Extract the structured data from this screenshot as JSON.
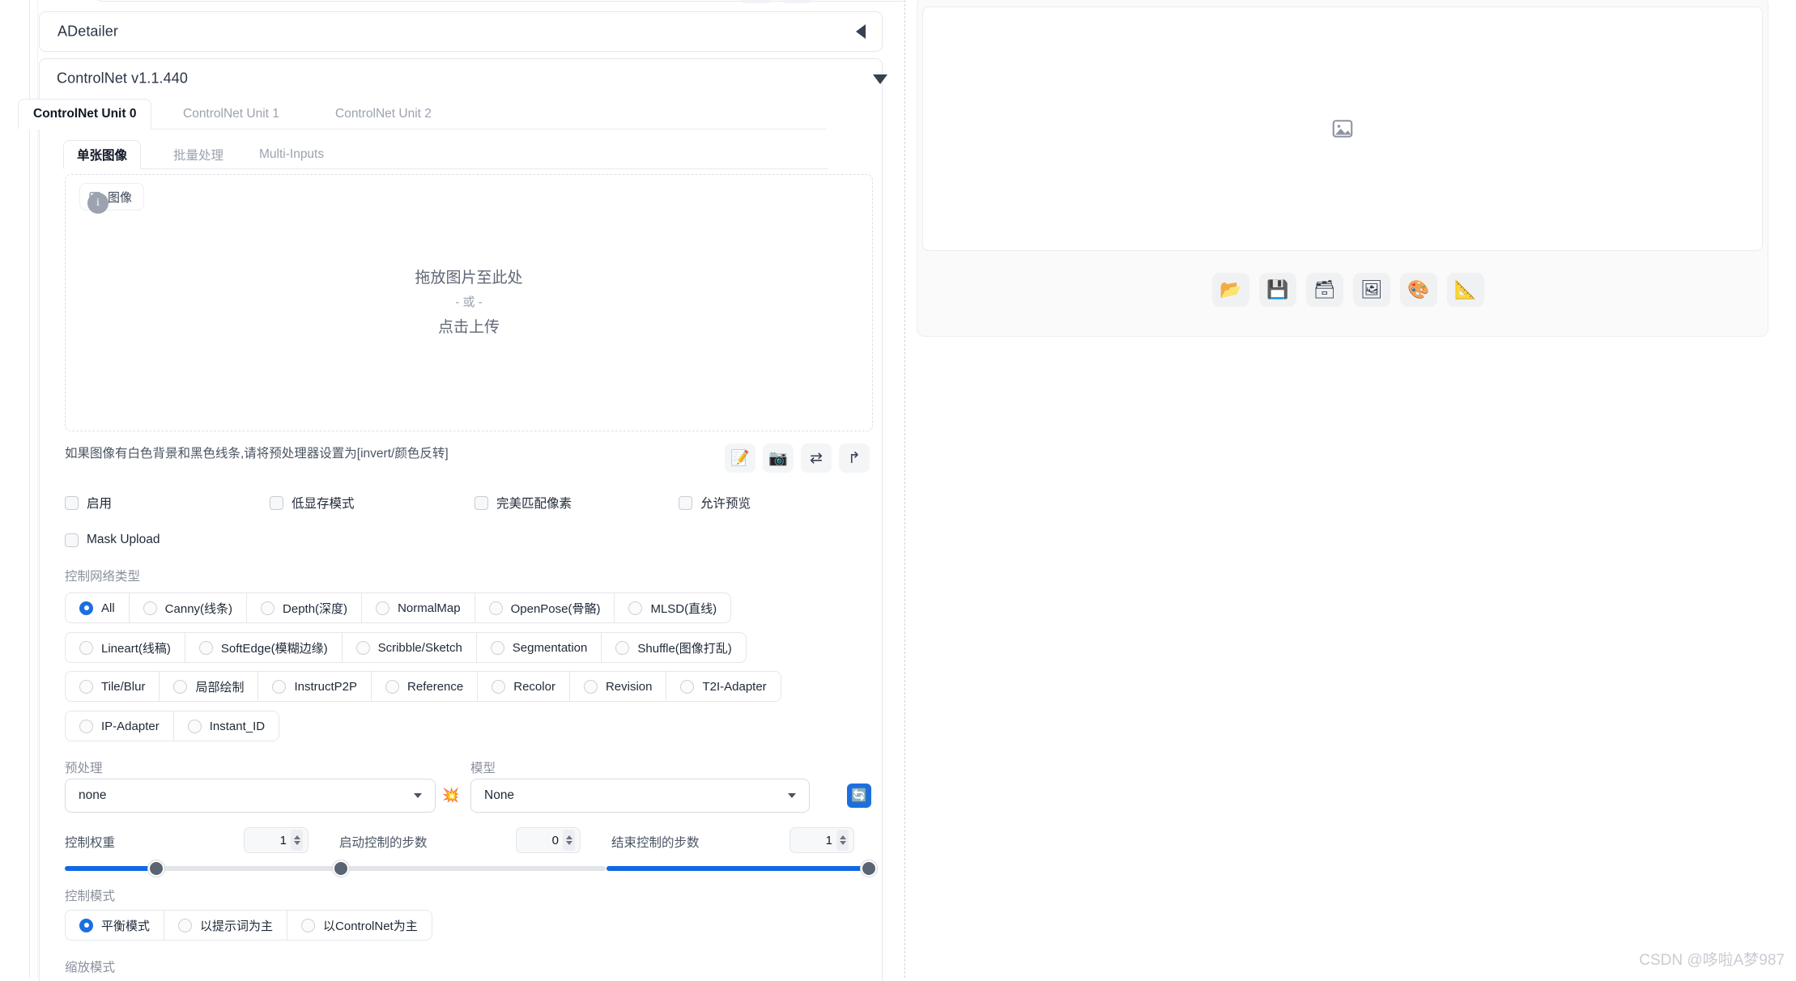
{
  "accordions": {
    "adetailer": {
      "title": "ADetailer",
      "arrow": "triangle-left"
    },
    "controlnet": {
      "title": "ControlNet v1.1.440",
      "arrow": "triangle-down"
    }
  },
  "unit_tabs": [
    {
      "label": "ControlNet Unit 0",
      "active": true
    },
    {
      "label": "ControlNet Unit 1",
      "active": false
    },
    {
      "label": "ControlNet Unit 2",
      "active": false
    }
  ],
  "image_tabs": [
    {
      "label": "单张图像",
      "active": true
    },
    {
      "label": "批量处理",
      "active": false
    },
    {
      "label": "Multi-Inputs",
      "active": false
    }
  ],
  "dropzone": {
    "chip_label": "图像",
    "chip_icon": "image-icon",
    "badge": "i",
    "line1": "拖放图片至此处",
    "line2": "- 或 -",
    "line3": "点击上传"
  },
  "hint": "如果图像有白色背景和黑色线条,请将预处理器设置为[invert/颜色反转]",
  "image_tools": [
    {
      "name": "edit-note-icon",
      "glyph": "📝"
    },
    {
      "name": "camera-icon",
      "glyph": "📷"
    },
    {
      "name": "swap-arrows-icon",
      "glyph": "⇄"
    },
    {
      "name": "undo-arrow-icon",
      "glyph": "↱"
    }
  ],
  "checkboxes": [
    {
      "label": "启用",
      "checked": false
    },
    {
      "label": "低显存模式",
      "checked": false
    },
    {
      "label": "完美匹配像素",
      "checked": false
    },
    {
      "label": "允许预览",
      "checked": false
    },
    {
      "label": "Mask Upload",
      "checked": false
    }
  ],
  "control_type": {
    "label": "控制网络类型",
    "rows": [
      [
        {
          "label": "All",
          "selected": true
        },
        {
          "label": "Canny(线条)",
          "selected": false
        },
        {
          "label": "Depth(深度)",
          "selected": false
        },
        {
          "label": "NormalMap",
          "selected": false
        },
        {
          "label": "OpenPose(骨骼)",
          "selected": false
        },
        {
          "label": "MLSD(直线)",
          "selected": false
        }
      ],
      [
        {
          "label": "Lineart(线稿)",
          "selected": false
        },
        {
          "label": "SoftEdge(模糊边缘)",
          "selected": false
        },
        {
          "label": "Scribble/Sketch",
          "selected": false
        },
        {
          "label": "Segmentation",
          "selected": false
        },
        {
          "label": "Shuffle(图像打乱)",
          "selected": false
        }
      ],
      [
        {
          "label": "Tile/Blur",
          "selected": false
        },
        {
          "label": "局部绘制",
          "selected": false
        },
        {
          "label": "InstructP2P",
          "selected": false
        },
        {
          "label": "Reference",
          "selected": false
        },
        {
          "label": "Recolor",
          "selected": false
        },
        {
          "label": "Revision",
          "selected": false
        },
        {
          "label": "T2I-Adapter",
          "selected": false
        }
      ],
      [
        {
          "label": "IP-Adapter",
          "selected": false
        },
        {
          "label": "Instant_ID",
          "selected": false
        }
      ]
    ]
  },
  "preprocessor": {
    "label": "预处理",
    "value": "none",
    "explode_icon": "explosion-icon",
    "explode_glyph": "💥"
  },
  "model": {
    "label": "模型",
    "value": "None",
    "refresh_icon": "refresh-icon",
    "refresh_glyph": "🔄"
  },
  "sliders": [
    {
      "label": "控制权重",
      "value": "1",
      "fill_pct": 34
    },
    {
      "label": "启动控制的步数",
      "value": "0",
      "fill_pct": 0
    },
    {
      "label": "结束控制的步数",
      "value": "1",
      "fill_pct": 100
    }
  ],
  "control_mode": {
    "label": "控制模式",
    "options": [
      {
        "label": "平衡模式",
        "selected": true
      },
      {
        "label": "以提示词为主",
        "selected": false
      },
      {
        "label": "以ControlNet为主",
        "selected": false
      }
    ]
  },
  "resize_mode": {
    "label": "缩放模式"
  },
  "output": {
    "placeholder_icon": "image-placeholder-icon",
    "tools": [
      {
        "name": "folder-icon",
        "glyph": "📂"
      },
      {
        "name": "save-floppy-icon",
        "glyph": "💾"
      },
      {
        "name": "card-file-box-icon",
        "glyph": "🗃"
      },
      {
        "name": "framed-picture-icon",
        "glyph": "🖼"
      },
      {
        "name": "artist-palette-icon",
        "glyph": "🎨"
      },
      {
        "name": "triangular-ruler-icon",
        "glyph": "📐"
      }
    ]
  },
  "watermark": "CSDN @哆啦A梦987",
  "colors": {
    "accent": "#1d6fe0",
    "slider_fill": "#1168e3",
    "thumb": "#5b6472"
  }
}
